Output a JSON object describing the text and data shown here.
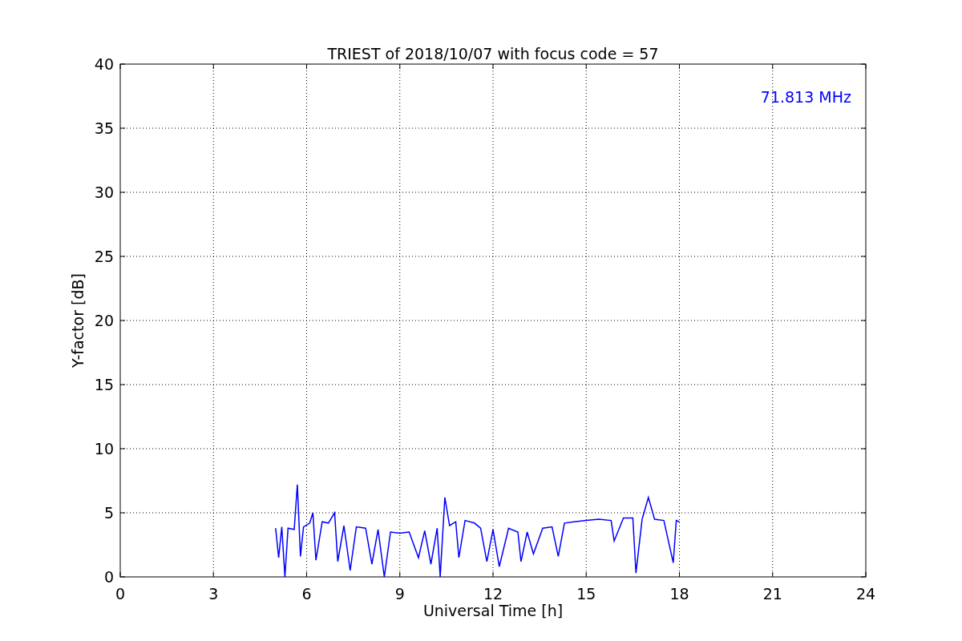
{
  "figure": {
    "chart_data": {
      "type": "line",
      "title": "TRIEST of 2018/10/07 with focus code = 57",
      "xlabel": "Universal Time [h]",
      "ylabel": "Y-factor [dB]",
      "x": [
        5.0,
        5.1,
        5.2,
        5.3,
        5.4,
        5.6,
        5.7,
        5.8,
        5.9,
        6.1,
        6.2,
        6.3,
        6.5,
        6.7,
        6.9,
        7.0,
        7.2,
        7.4,
        7.6,
        7.9,
        8.1,
        8.3,
        8.5,
        8.7,
        9.0,
        9.3,
        9.6,
        9.8,
        10.0,
        10.2,
        10.3,
        10.45,
        10.6,
        10.8,
        10.9,
        11.1,
        11.4,
        11.6,
        11.8,
        12.0,
        12.2,
        12.5,
        12.8,
        12.9,
        13.1,
        13.3,
        13.6,
        13.9,
        14.1,
        14.3,
        14.6,
        15.0,
        15.4,
        15.8,
        15.9,
        16.2,
        16.5,
        16.6,
        16.8,
        17.0,
        17.2,
        17.5,
        17.8,
        17.9,
        18.0
      ],
      "series": [
        {
          "color": "#0000ff",
          "values": [
            3.8,
            1.5,
            3.9,
            0.0,
            3.8,
            3.7,
            7.2,
            1.6,
            3.9,
            4.2,
            5.0,
            1.3,
            4.3,
            4.2,
            5.0,
            1.2,
            4.0,
            0.5,
            3.9,
            3.8,
            1.0,
            3.7,
            0.0,
            3.5,
            3.4,
            3.5,
            1.5,
            3.6,
            1.0,
            3.8,
            0.0,
            6.2,
            4.0,
            4.3,
            1.5,
            4.4,
            4.2,
            3.8,
            1.2,
            3.7,
            0.8,
            3.8,
            3.5,
            1.2,
            3.5,
            1.8,
            3.8,
            3.9,
            1.6,
            4.2,
            4.3,
            4.4,
            4.5,
            4.4,
            2.8,
            4.6,
            4.6,
            0.3,
            4.5,
            6.2,
            4.5,
            4.4,
            1.1,
            4.4,
            4.3
          ]
        }
      ],
      "xlim": [
        0,
        24
      ],
      "ylim": [
        0,
        40
      ],
      "xticks": [
        0,
        3,
        6,
        9,
        12,
        15,
        18,
        21,
        24
      ],
      "yticks": [
        0,
        5,
        10,
        15,
        20,
        25,
        30,
        35,
        40
      ],
      "grid": true,
      "annotations": [
        "71.813 MHz"
      ]
    }
  }
}
